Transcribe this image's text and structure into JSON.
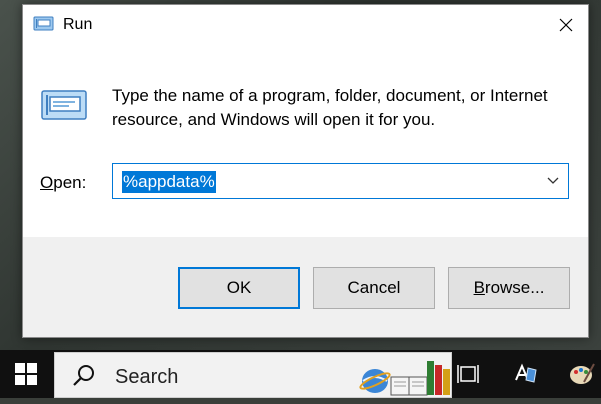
{
  "dialog": {
    "title": "Run",
    "description": "Type the name of a program, folder, document, or Internet resource, and Windows will open it for you.",
    "open_label_hotkey": "O",
    "open_label_rest": "pen:",
    "input_value": "%appdata%",
    "ok_label": "OK",
    "cancel_label": "Cancel",
    "browse_label_hotkey": "B",
    "browse_label_rest": "rowse...",
    "accent_color": "#0078d7"
  },
  "taskbar": {
    "search_text": "Search"
  }
}
